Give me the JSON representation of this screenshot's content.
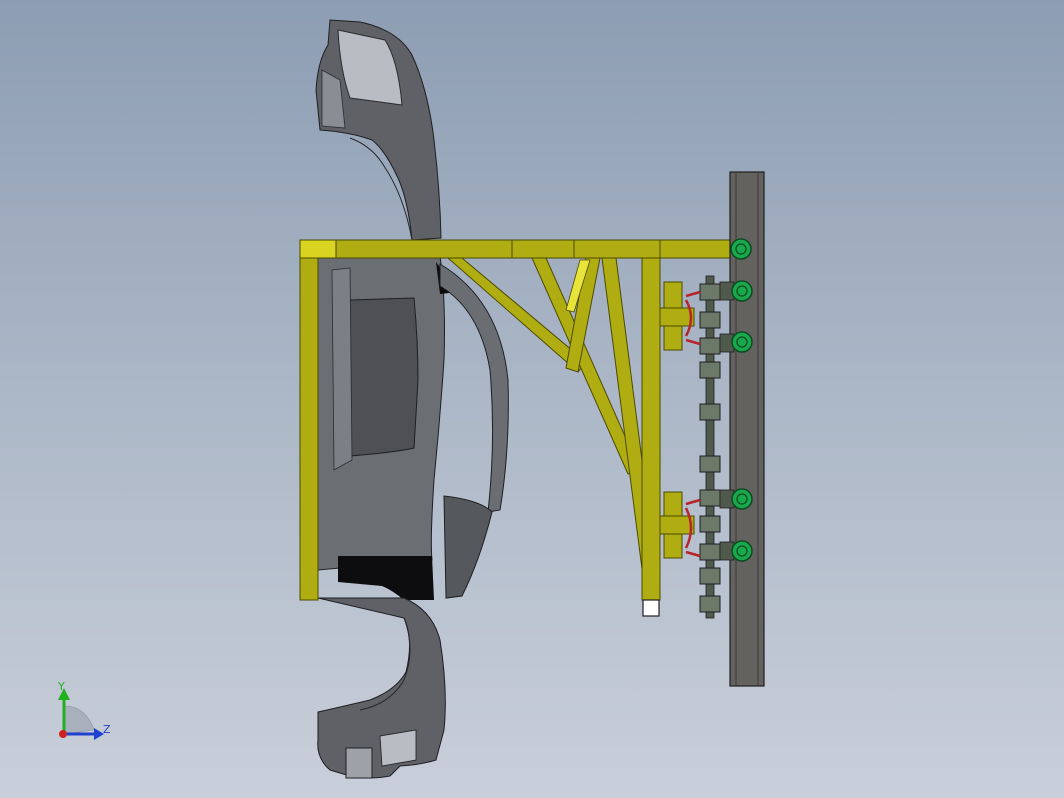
{
  "viewport": {
    "background_top": "#8d9db3",
    "background_bottom": "#c9cfda"
  },
  "model": {
    "car_body_color": "#5f6166",
    "car_highlight_color": "#b9bcc2",
    "frame_color": "#b0ad12",
    "frame_edge_color": "#4d4a00",
    "rail_color": "#64625f",
    "wheel_color": "#1aa84c",
    "chain_color": "#4f5a4c",
    "accent_red": "#b8242a"
  },
  "triad": {
    "y_label": "Y",
    "z_label": "Z",
    "y_color": "#20b020",
    "z_color": "#2040d0",
    "x_color": "#d02020"
  }
}
